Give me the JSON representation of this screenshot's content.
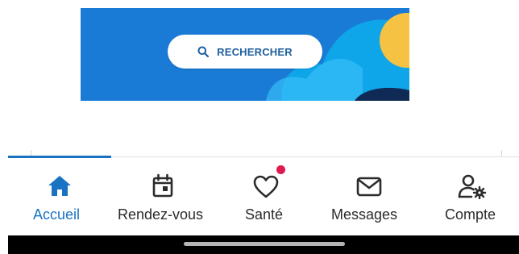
{
  "banner": {
    "search_label": "RECHERCHER",
    "search_icon": "search-icon",
    "colors": {
      "background": "#1a7bd6",
      "wave": "#0ea5e9",
      "sun": "#f6c244",
      "dark": "#0f2b55"
    }
  },
  "nav": {
    "active": "accueil",
    "accent_color": "#1a73c2",
    "badge_color": "#e0194f",
    "items": [
      {
        "id": "accueil",
        "label": "Accueil",
        "icon": "home-icon"
      },
      {
        "id": "rendez-vous",
        "label": "Rendez-vous",
        "icon": "calendar-icon"
      },
      {
        "id": "sante",
        "label": "Santé",
        "icon": "heart-icon",
        "has_badge": true
      },
      {
        "id": "messages",
        "label": "Messages",
        "icon": "envelope-icon"
      },
      {
        "id": "compte",
        "label": "Compte",
        "icon": "user-settings-icon"
      }
    ]
  }
}
